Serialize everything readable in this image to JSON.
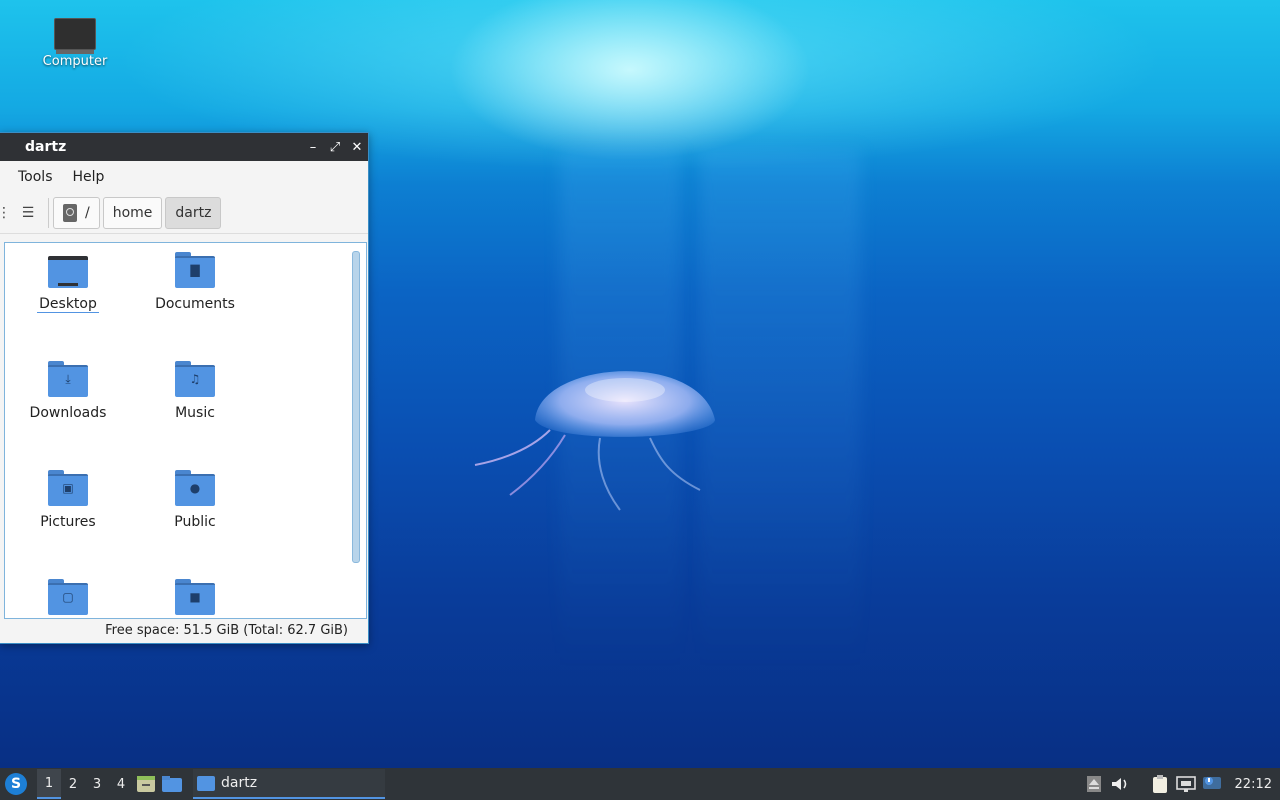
{
  "desktop": {
    "icons": [
      {
        "label": "Computer",
        "icon": "monitor-icon"
      }
    ]
  },
  "window": {
    "title": "dartz",
    "controls": [
      "minimize-icon",
      "maximize-icon",
      "close-icon"
    ],
    "menu": [
      "Tools",
      "Help"
    ],
    "path": [
      {
        "label": "/",
        "icon": "drive-icon"
      },
      {
        "label": "home"
      },
      {
        "label": "dartz"
      }
    ],
    "items": [
      {
        "name": "Desktop",
        "icon": "desktop-folder-icon",
        "glyph": "",
        "selected": true
      },
      {
        "name": "Documents",
        "icon": "documents-folder-icon",
        "glyph": "▇"
      },
      {
        "name": "Downloads",
        "icon": "downloads-folder-icon",
        "glyph": "⤓"
      },
      {
        "name": "Music",
        "icon": "music-folder-icon",
        "glyph": "♫"
      },
      {
        "name": "Pictures",
        "icon": "pictures-folder-icon",
        "glyph": "▣"
      },
      {
        "name": "Public",
        "icon": "public-folder-icon",
        "glyph": "●"
      },
      {
        "name": "",
        "icon": "templates-folder-icon",
        "glyph": "▢"
      },
      {
        "name": "",
        "icon": "videos-folder-icon",
        "glyph": "■"
      }
    ],
    "status": "Free space: 51.5 GiB (Total: 62.7 GiB)"
  },
  "taskbar": {
    "workspaces": [
      "1",
      "2",
      "3",
      "4"
    ],
    "current_workspace": "1",
    "task_label": "dartz",
    "clock": "22:12"
  },
  "colors": {
    "accent": "#5294e2",
    "titlebar": "#2f3135",
    "taskbar": "#2f3439"
  }
}
